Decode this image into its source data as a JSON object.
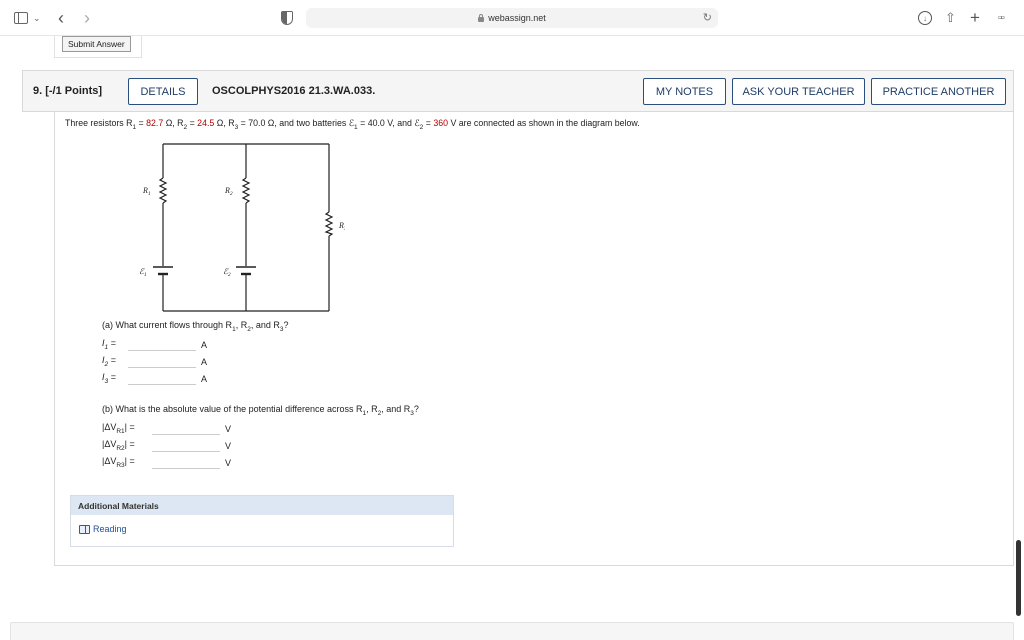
{
  "browser": {
    "url": "webassign.net"
  },
  "submit_label": "Submit Answer",
  "question": {
    "number_points": "9. [-/1 Points]",
    "details_label": "DETAILS",
    "code": "OSCOLPHYS2016 21.3.WA.033.",
    "my_notes_label": "MY NOTES",
    "ask_teacher_label": "ASK YOUR TEACHER",
    "practice_label": "PRACTICE ANOTHER"
  },
  "statement": {
    "intro": "Three resistors R",
    "r1": "82.7",
    "r2": "24.5",
    "r3": "70.0",
    "e1": "40.0",
    "e2": "360",
    "tail": "V are connected as shown in the diagram below."
  },
  "circuit_labels": {
    "r1": "R",
    "r2": "R",
    "r3": "R",
    "e1": "ℰ",
    "e2": "ℰ"
  },
  "part_a": {
    "prompt": "(a) What current flows through R",
    "fields": [
      {
        "label": "I",
        "sub": "1",
        "unit": "A",
        "value": ""
      },
      {
        "label": "I",
        "sub": "2",
        "unit": "A",
        "value": ""
      },
      {
        "label": "I",
        "sub": "3",
        "unit": "A",
        "value": ""
      }
    ]
  },
  "part_b": {
    "prompt": "(b) What is the absolute value of the potential difference across R",
    "fields": [
      {
        "label": "|ΔV",
        "sub": "R1",
        "unit": "V",
        "value": ""
      },
      {
        "label": "|ΔV",
        "sub": "R2",
        "unit": "V",
        "value": ""
      },
      {
        "label": "|ΔV",
        "sub": "R3",
        "unit": "V",
        "value": ""
      }
    ]
  },
  "additional_materials": {
    "heading": "Additional Materials",
    "reading_label": "Reading"
  }
}
